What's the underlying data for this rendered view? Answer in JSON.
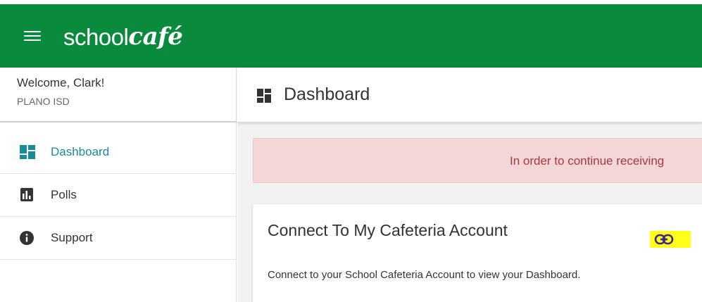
{
  "header": {
    "logo_school": "school",
    "logo_cafe": "café",
    "brand_color": "#0a8a3c"
  },
  "sidebar": {
    "welcome": "Welcome, Clark!",
    "organization": "PLANO ISD",
    "items": [
      {
        "label": "Dashboard",
        "icon": "dashboard-icon",
        "active": true
      },
      {
        "label": "Polls",
        "icon": "poll-icon",
        "active": false
      },
      {
        "label": "Support",
        "icon": "info-icon",
        "active": false
      }
    ],
    "active_color": "#1b8a9a"
  },
  "main": {
    "title": "Dashboard",
    "alert_text": "In order to continue receiving",
    "card": {
      "title": "Connect To My Cafeteria Account",
      "description": "Connect to your School Cafeteria Account to view your Dashboard.",
      "action_icon": "link-icon",
      "highlight_color": "#ffff1a"
    }
  }
}
